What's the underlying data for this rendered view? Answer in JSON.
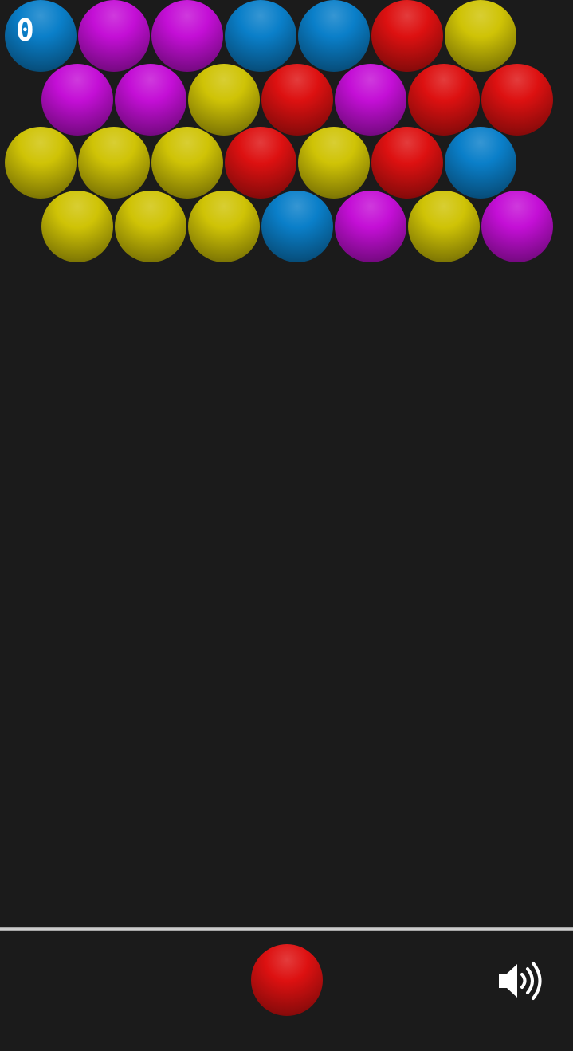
{
  "game": {
    "score": "0",
    "colors": {
      "blue": "#0a7fc9",
      "purple": "#c40fd6",
      "yellow": "#cfc306",
      "red": "#dd1111",
      "background": "#1b1b1b"
    },
    "grid": [
      [
        "blue",
        "purple",
        "purple",
        "blue",
        "blue",
        "red",
        "yellow"
      ],
      [
        "purple",
        "purple",
        "yellow",
        "red",
        "purple",
        "red",
        "red"
      ],
      [
        "yellow",
        "yellow",
        "yellow",
        "red",
        "yellow",
        "red",
        "blue"
      ],
      [
        "yellow",
        "yellow",
        "yellow",
        "blue",
        "purple",
        "yellow",
        "purple"
      ]
    ],
    "current_bubble": "red",
    "sound_icon": "speaker-on-icon"
  }
}
